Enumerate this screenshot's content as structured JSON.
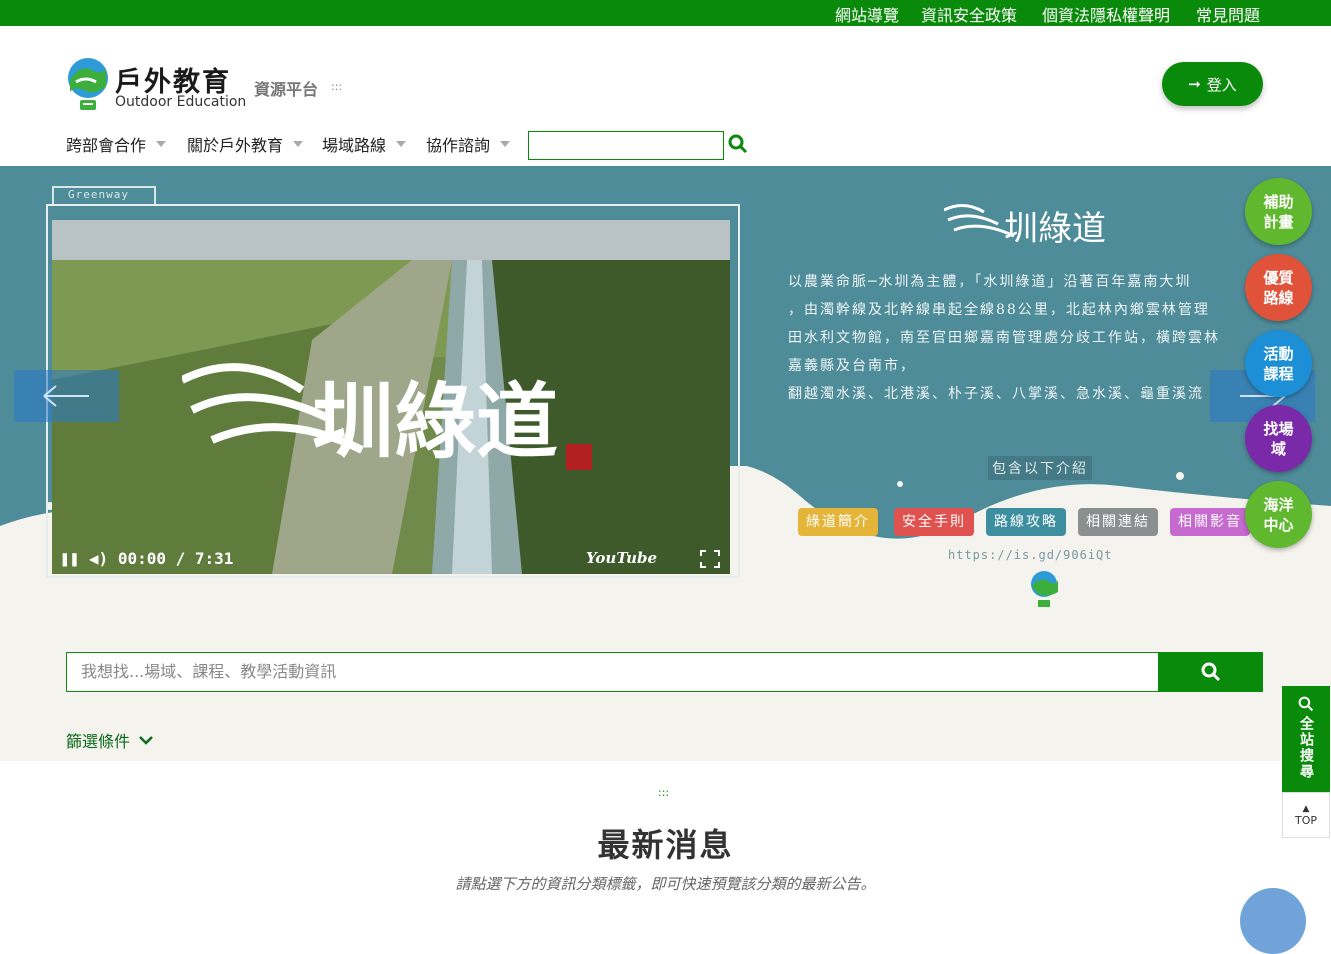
{
  "topbar": {
    "links": [
      "網站導覽",
      "資訊安全政策",
      "個資法隱私權聲明",
      "常見問題"
    ]
  },
  "header": {
    "logo_zh": "戶外教育",
    "logo_en": "Outdoor Education",
    "platform_label": "資源平台",
    "accesskey": ":::",
    "login_label": "登入",
    "nav": [
      "跨部會合作",
      "關於戶外教育",
      "場域路線",
      "協作諮詢"
    ],
    "nav_search_value": ""
  },
  "banner": {
    "frame_tab": "Greenway",
    "video_time": "00:00 / 7:31",
    "youtube_label": "YouTube",
    "title_glyphs": "圳綠道",
    "description_lines": [
      "以農業命脈─水圳為主體，「水圳綠道」沿著百年嘉南大圳",
      "，由濁幹線及北幹線串起全線88公里，北起林內鄉雲林管理",
      "田水利文物館，南至官田鄉嘉南管理處分歧工作站，橫跨雲林",
      "嘉義縣及台南市，",
      "翻越濁水溪、北港溪、朴子溪、八掌溪、急水溪、龜重溪流"
    ],
    "intro_label": "包含以下介紹",
    "tags": [
      {
        "label": "綠道簡介",
        "color": "#e5b53a"
      },
      {
        "label": "安全手則",
        "color": "#e0524f"
      },
      {
        "label": "路線攻略",
        "color": "#3d8fa0"
      },
      {
        "label": "相關連結",
        "color": "#8a8f8f"
      },
      {
        "label": "相關影音",
        "color": "#c66ad0"
      }
    ],
    "url": "https://is.gd/906iQt"
  },
  "float_buttons": [
    {
      "label": "補助計畫",
      "color": "#5fb82d"
    },
    {
      "label": "優質路線",
      "color": "#e0523a"
    },
    {
      "label": "活動課程",
      "color": "#1d8fd6"
    },
    {
      "label": "找場域",
      "color": "#7a2aa8"
    },
    {
      "label": "海洋中心",
      "color": "#5fb82d"
    }
  ],
  "search": {
    "placeholder": "我想找...場域、課程、教學活動資訊",
    "filter_label": "篩選條件"
  },
  "news": {
    "accesskey": ":::",
    "title": "最新消息",
    "subtitle": "請點選下方的資訊分類標籤，即可快速預覽該分類的最新公告。"
  },
  "side": {
    "search_label": "全站搜尋",
    "top_label": "TOP"
  }
}
